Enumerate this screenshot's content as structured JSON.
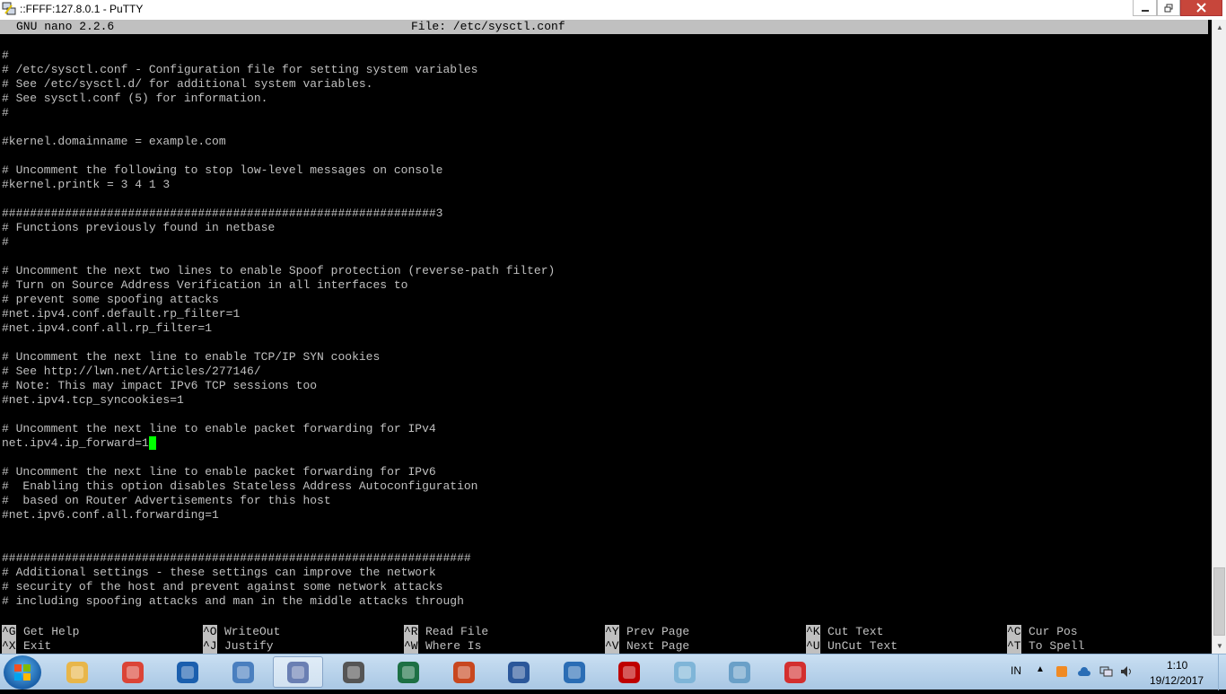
{
  "window": {
    "title": "::FFFF:127.8.0.1 - PuTTY"
  },
  "nano": {
    "version": "GNU nano 2.2.6",
    "file_label": "File: /etc/sysctl.conf"
  },
  "editor": {
    "lines": [
      "",
      "#",
      "# /etc/sysctl.conf - Configuration file for setting system variables",
      "# See /etc/sysctl.d/ for additional system variables.",
      "# See sysctl.conf (5) for information.",
      "#",
      "",
      "#kernel.domainname = example.com",
      "",
      "# Uncomment the following to stop low-level messages on console",
      "#kernel.printk = 3 4 1 3",
      "",
      "##############################################################3",
      "# Functions previously found in netbase",
      "#",
      "",
      "# Uncomment the next two lines to enable Spoof protection (reverse-path filter)",
      "# Turn on Source Address Verification in all interfaces to",
      "# prevent some spoofing attacks",
      "#net.ipv4.conf.default.rp_filter=1",
      "#net.ipv4.conf.all.rp_filter=1",
      "",
      "# Uncomment the next line to enable TCP/IP SYN cookies",
      "# See http://lwn.net/Articles/277146/",
      "# Note: This may impact IPv6 TCP sessions too",
      "#net.ipv4.tcp_syncookies=1",
      "",
      "# Uncomment the next line to enable packet forwarding for IPv4",
      "net.ipv4.ip_forward=1",
      "",
      "# Uncomment the next line to enable packet forwarding for IPv6",
      "#  Enabling this option disables Stateless Address Autoconfiguration",
      "#  based on Router Advertisements for this host",
      "#net.ipv6.conf.all.forwarding=1",
      "",
      "",
      "###################################################################",
      "# Additional settings - these settings can improve the network",
      "# security of the host and prevent against some network attacks",
      "# including spoofing attacks and man in the middle attacks through"
    ],
    "cursor_line": 28
  },
  "shortcuts": [
    {
      "key": "^G",
      "label": "Get Help"
    },
    {
      "key": "^O",
      "label": "WriteOut"
    },
    {
      "key": "^R",
      "label": "Read File"
    },
    {
      "key": "^Y",
      "label": "Prev Page"
    },
    {
      "key": "^K",
      "label": "Cut Text"
    },
    {
      "key": "^C",
      "label": "Cur Pos"
    },
    {
      "key": "^X",
      "label": "Exit"
    },
    {
      "key": "^J",
      "label": "Justify"
    },
    {
      "key": "^W",
      "label": "Where Is"
    },
    {
      "key": "^V",
      "label": "Next Page"
    },
    {
      "key": "^U",
      "label": "UnCut Text"
    },
    {
      "key": "^T",
      "label": "To Spell"
    }
  ],
  "taskbar": {
    "apps": [
      {
        "name": "file-explorer-icon",
        "color": "#e8b64a"
      },
      {
        "name": "chrome-icon",
        "color": "#db4437"
      },
      {
        "name": "browser-icon",
        "color": "#1b5fae"
      },
      {
        "name": "remote-desktop-icon",
        "color": "#4a7fbf"
      },
      {
        "name": "putty-icon",
        "color": "#6a7fb3"
      },
      {
        "name": "skyrim-icon",
        "color": "#555555"
      },
      {
        "name": "excel-icon",
        "color": "#1d7044"
      },
      {
        "name": "powerpoint-icon",
        "color": "#c8471f"
      },
      {
        "name": "word-icon",
        "color": "#2b579a"
      },
      {
        "name": "network-app-icon",
        "color": "#2a6db5"
      },
      {
        "name": "filezilla-icon",
        "color": "#bf0000"
      },
      {
        "name": "paint-icon",
        "color": "#7fb5d8"
      },
      {
        "name": "notepad-icon",
        "color": "#6aa0c8"
      },
      {
        "name": "help-lifebuoy-icon",
        "color": "#d32f2f"
      }
    ],
    "active_app_index": 4,
    "language": "IN",
    "time": "1:10",
    "date": "19/12/2017"
  }
}
